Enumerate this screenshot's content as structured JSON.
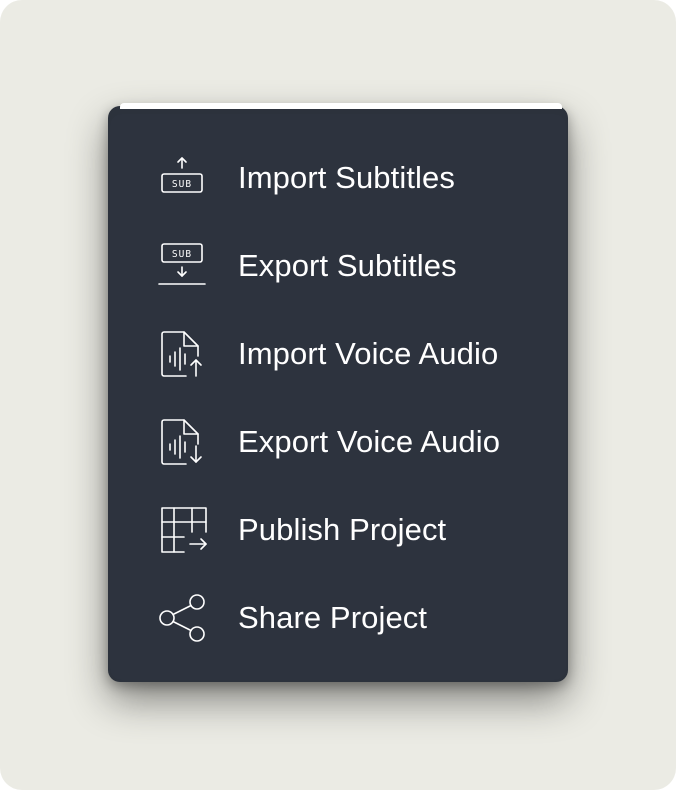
{
  "menu": {
    "items": [
      {
        "label": "Import Subtitles",
        "icon": "import-subtitles-icon"
      },
      {
        "label": "Export Subtitles",
        "icon": "export-subtitles-icon"
      },
      {
        "label": "Import Voice Audio",
        "icon": "import-audio-icon"
      },
      {
        "label": "Export Voice Audio",
        "icon": "export-audio-icon"
      },
      {
        "label": "Publish Project",
        "icon": "publish-icon"
      },
      {
        "label": "Share Project",
        "icon": "share-icon"
      }
    ],
    "sub_badge": "SUB"
  },
  "colors": {
    "menu_background": "#2d333e",
    "text": "#ffffff",
    "page_background": "#ebebe4"
  }
}
